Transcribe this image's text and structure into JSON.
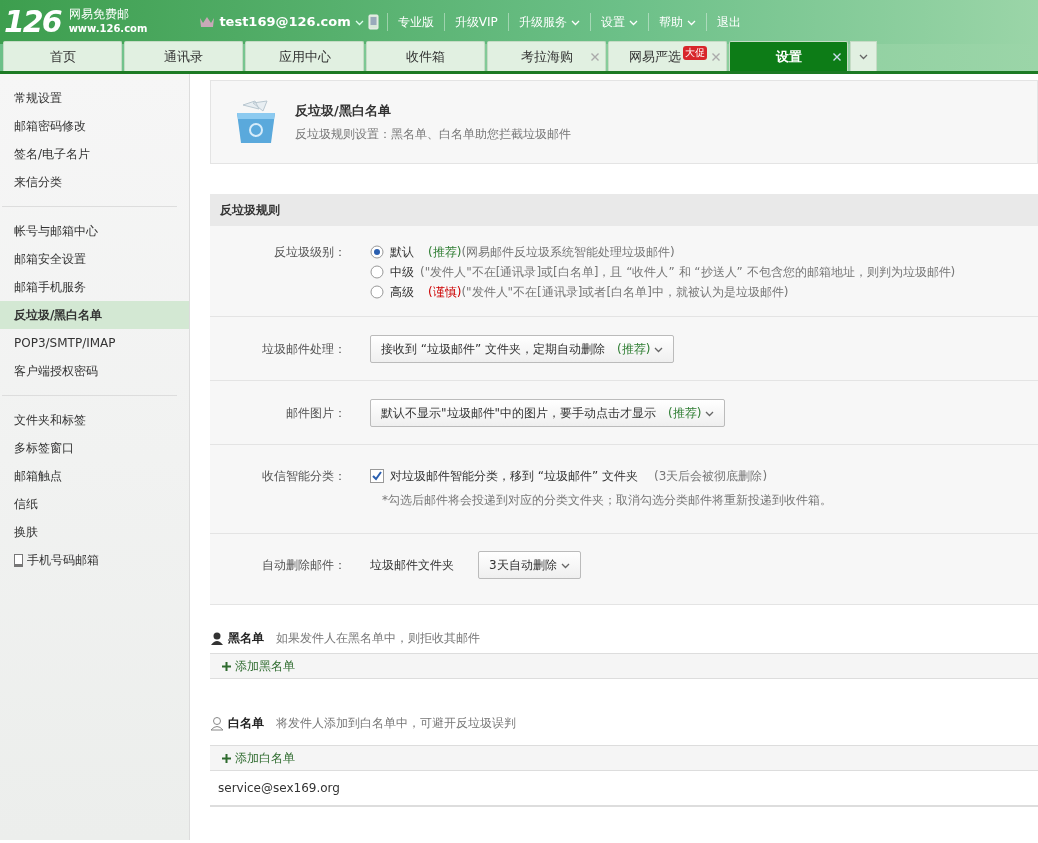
{
  "header": {
    "logo": "126",
    "brand": "网易免费邮",
    "url": "www.126.com",
    "user": "test169@126.com",
    "links": [
      {
        "label": "专业版",
        "dropdown": false
      },
      {
        "label": "升级VIP",
        "dropdown": false
      },
      {
        "label": "升级服务",
        "dropdown": true
      },
      {
        "label": "设置",
        "dropdown": true
      },
      {
        "label": "帮助",
        "dropdown": true
      },
      {
        "label": "退出",
        "dropdown": false
      }
    ]
  },
  "tabs": [
    {
      "label": "首页",
      "closable": false,
      "selected": false
    },
    {
      "label": "通讯录",
      "closable": false,
      "selected": false
    },
    {
      "label": "应用中心",
      "closable": false,
      "selected": false
    },
    {
      "label": "收件箱",
      "closable": false,
      "selected": false
    },
    {
      "label": "考拉海购",
      "closable": true,
      "selected": false
    },
    {
      "label": "网易严选",
      "closable": true,
      "selected": false,
      "badge": "大促"
    },
    {
      "label": "设置",
      "closable": true,
      "selected": true
    }
  ],
  "sidebar": {
    "groups": [
      {
        "items": [
          {
            "label": "常规设置",
            "kind": "text",
            "selected": false
          },
          {
            "label": "邮箱密码修改",
            "kind": "text",
            "selected": false
          },
          {
            "label": "签名/电子名片",
            "kind": "text",
            "selected": false
          },
          {
            "label": "来信分类",
            "kind": "text",
            "selected": false
          }
        ]
      },
      {
        "items": [
          {
            "label": "帐号与邮箱中心",
            "kind": "text",
            "selected": false
          },
          {
            "label": "邮箱安全设置",
            "kind": "text",
            "selected": false
          },
          {
            "label": "邮箱手机服务",
            "kind": "text",
            "selected": false
          },
          {
            "label": "反垃圾/黑白名单",
            "kind": "text",
            "selected": true
          },
          {
            "label": "POP3/SMTP/IMAP",
            "kind": "text",
            "selected": false
          },
          {
            "label": "客户端授权密码",
            "kind": "text",
            "selected": false
          }
        ]
      },
      {
        "items": [
          {
            "label": "文件夹和标签",
            "kind": "text",
            "selected": false
          },
          {
            "label": "多标签窗口",
            "kind": "text",
            "selected": false
          },
          {
            "label": "邮箱触点",
            "kind": "text",
            "selected": false
          },
          {
            "label": "信纸",
            "kind": "text",
            "selected": false
          },
          {
            "label": "换肤",
            "kind": "text",
            "selected": false
          },
          {
            "label": "手机号码邮箱",
            "kind": "phone",
            "selected": false
          }
        ]
      }
    ]
  },
  "page_header": {
    "title": "反垃圾/黑白名单",
    "subtitle": "反垃圾规则设置：黑名单、白名单助您拦截垃圾邮件"
  },
  "rules": {
    "title": "反垃圾规则",
    "rows": [
      {
        "kind": "radio",
        "label": "反垃圾级别：",
        "options": [
          {
            "label": "默认",
            "tag": {
              "text": "(推荐)",
              "color": "#2e7d32"
            },
            "note": "(网易邮件反垃圾系统智能处理垃圾邮件)",
            "selected": true
          },
          {
            "label": "中级",
            "note": "(\"发件人\"不在[通讯录]或[白名单]，且 “收件人” 和 “抄送人” 不包含您的邮箱地址，则判为垃圾邮件)",
            "selected": false
          },
          {
            "label": "高级",
            "tag": {
              "text": "(谨慎)",
              "color": "#cc0000"
            },
            "note": "(\"发件人\"不在[通讯录]或者[白名单]中，就被认为是垃圾邮件)",
            "selected": false
          }
        ]
      },
      {
        "kind": "select",
        "label": "垃圾邮件处理：",
        "value": "接收到 “垃圾邮件” 文件夹，定期自动删除",
        "tag": "(推荐)"
      },
      {
        "kind": "select",
        "label": "邮件图片：",
        "value": "默认不显示\"垃圾邮件\"中的图片，要手动点击才显示",
        "tag": "(推荐)"
      },
      {
        "kind": "checkbox",
        "label": "收信智能分类：",
        "checked": true,
        "text": "对垃圾邮件智能分类，移到 “垃圾邮件” 文件夹",
        "note": "(3天后会被彻底删除)",
        "hint": "*勾选后邮件将会投递到对应的分类文件夹；取消勾选分类邮件将重新投递到收件箱。"
      },
      {
        "kind": "folder_select",
        "label": "自动删除邮件：",
        "folder": "垃圾邮件文件夹",
        "value": "3天自动删除"
      }
    ]
  },
  "lists": [
    {
      "kind": "black",
      "title": "黑名单",
      "description": "如果发件人在黑名单中，则拒收其邮件",
      "add_label": "添加黑名单"
    },
    {
      "kind": "white",
      "title": "白名单",
      "description": "将发件人添加到白名单中，可避开反垃圾误判",
      "add_label": "添加白名单",
      "entries": [
        "service@sex169.org"
      ]
    }
  ]
}
